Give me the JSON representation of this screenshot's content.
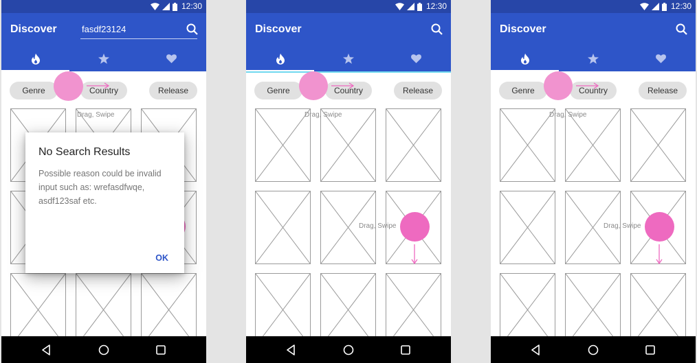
{
  "status": {
    "time": "12:30"
  },
  "phones": [
    {
      "title": "Discover",
      "search_value": "fasdf23124",
      "chips": [
        "Genre",
        "Country",
        "Release"
      ],
      "drag_hint": "Drag, Swipe",
      "dialog": {
        "title": "No Search Results",
        "body": "Possible reason could be invalid input such as: wrefasdfwqe, asdf123saf etc.",
        "ok": "OK"
      }
    },
    {
      "title": "Discover",
      "chips": [
        "Genre",
        "Country",
        "Release"
      ],
      "drag_hint_top": "Drag, Swipe",
      "drag_hint_side": "Drag, Swipe"
    },
    {
      "title": "Discover",
      "chips": [
        "Genre",
        "Country",
        "Release"
      ],
      "drag_hint_top": "Drag, Swipe",
      "drag_hint_side": "Drag, Swipe"
    }
  ],
  "tabs": [
    {
      "icon": "flame-icon"
    },
    {
      "icon": "star-icon"
    },
    {
      "icon": "heart-icon"
    }
  ],
  "colors": {
    "primary": "#2e55c8",
    "status_bar": "#2746a8",
    "touch_light": "#f193cf",
    "touch_dark": "#ee6ac0",
    "tab_accent": "#6fd8ef"
  }
}
